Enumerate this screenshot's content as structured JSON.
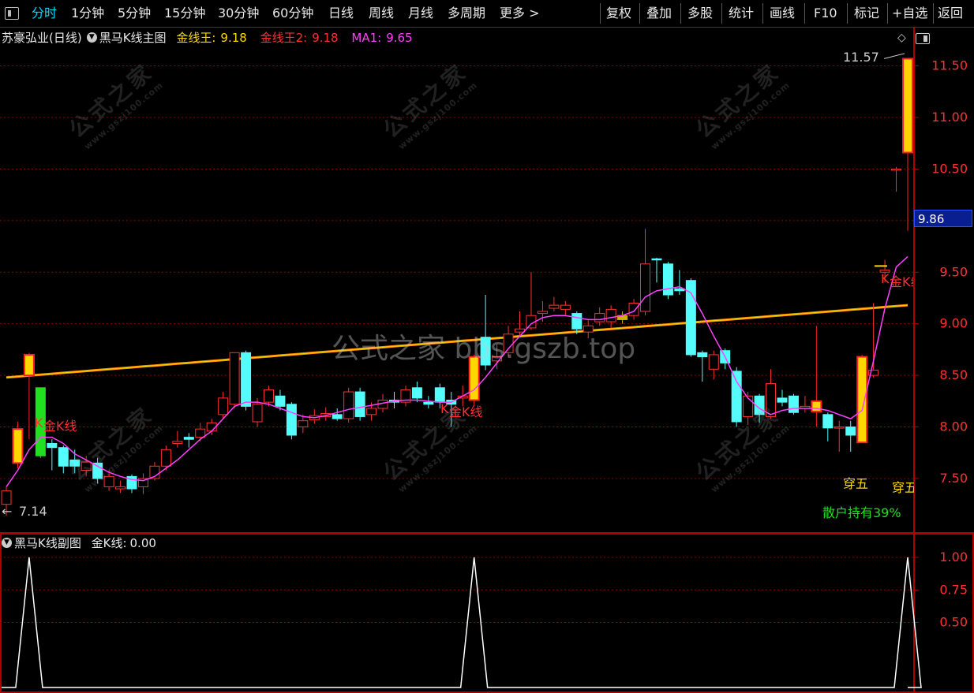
{
  "toolbar": {
    "tabs": [
      "分时",
      "1分钟",
      "5分钟",
      "15分钟",
      "30分钟",
      "60分钟",
      "日线",
      "周线",
      "月线",
      "多周期",
      "更多 >"
    ],
    "right": [
      "复权",
      "叠加",
      "多股",
      "统计",
      "画线",
      "F10",
      "标记",
      "+自选",
      "返回"
    ]
  },
  "main_panel": {
    "stock": "苏豪弘业(日线)",
    "indicator": "黑马K线主图",
    "legend": [
      {
        "name": "金线王:",
        "value": "9.18",
        "color": "#ffd700"
      },
      {
        "name": "金线王2:",
        "value": "9.18",
        "color": "#ff3030"
      },
      {
        "name": "MA1:",
        "value": "9.65",
        "color": "#ff40ff"
      }
    ],
    "current_price": "9.86",
    "high_label": "11.57",
    "low_label": "7.14",
    "signal_label": "金K线",
    "signal_prefix": "K",
    "cross_label": "穿五",
    "retail_hold": "散户持有39%"
  },
  "sub_panel": {
    "indicator": "黑马K线副图",
    "legend_name": "金K线:",
    "legend_value": "0.00"
  },
  "watermark": {
    "center": "公式之家 bbs.gszb.top",
    "diagonal_big": "公式之家",
    "diagonal_small": "www.gszj100.com"
  },
  "colors": {
    "up": "#ff3030",
    "down": "#54fcfc",
    "gold": "#ffd700",
    "ma": "#ff40ff",
    "grid": "#8b0000",
    "axis": "#b00000"
  },
  "chart_data": {
    "type": "candlestick",
    "y_ticks": [
      7.5,
      8.0,
      8.5,
      9.0,
      9.5,
      10.0,
      10.5,
      11.0,
      11.5
    ],
    "ylim": [
      6.98,
      11.68
    ],
    "sub_y_ticks": [
      0.5,
      0.75,
      1.0
    ],
    "candles": [
      {
        "o": 7.25,
        "c": 7.38,
        "h": 7.42,
        "l": 7.14
      },
      {
        "o": 7.65,
        "c": 7.98,
        "h": 8.05,
        "l": 7.6,
        "t": "gold"
      },
      {
        "o": 8.5,
        "c": 8.7,
        "h": 8.72,
        "l": 7.88,
        "t": "gold"
      },
      {
        "o": 8.38,
        "c": 7.72,
        "h": 8.38,
        "l": 7.7,
        "t": "green"
      },
      {
        "o": 7.84,
        "c": 7.8,
        "h": 7.88,
        "l": 7.58
      },
      {
        "o": 7.8,
        "c": 7.62,
        "h": 7.82,
        "l": 7.55
      },
      {
        "o": 7.68,
        "c": 7.62,
        "h": 7.78,
        "l": 7.55
      },
      {
        "o": 7.58,
        "c": 7.66,
        "h": 7.72,
        "l": 7.52
      },
      {
        "o": 7.65,
        "c": 7.5,
        "h": 7.7,
        "l": 7.45
      },
      {
        "o": 7.42,
        "c": 7.52,
        "h": 7.58,
        "l": 7.38
      },
      {
        "o": 7.4,
        "c": 7.42,
        "h": 7.48,
        "l": 7.36
      },
      {
        "o": 7.52,
        "c": 7.4,
        "h": 7.54,
        "l": 7.36
      },
      {
        "o": 7.42,
        "c": 7.5,
        "h": 7.55,
        "l": 7.35
      },
      {
        "o": 7.5,
        "c": 7.62,
        "h": 7.66,
        "l": 7.48
      },
      {
        "o": 7.62,
        "c": 7.78,
        "h": 7.82,
        "l": 7.58
      },
      {
        "o": 7.84,
        "c": 7.86,
        "h": 7.96,
        "l": 7.8
      },
      {
        "o": 7.9,
        "c": 7.88,
        "h": 7.94,
        "l": 7.8
      },
      {
        "o": 7.9,
        "c": 7.98,
        "h": 8.04,
        "l": 7.86
      },
      {
        "o": 7.96,
        "c": 8.04,
        "h": 8.08,
        "l": 7.92
      },
      {
        "o": 8.12,
        "c": 8.28,
        "h": 8.34,
        "l": 8.08
      },
      {
        "o": 8.22,
        "c": 8.72,
        "h": 8.72,
        "l": 8.18
      },
      {
        "o": 8.72,
        "c": 8.2,
        "h": 8.74,
        "l": 8.16
      },
      {
        "o": 8.05,
        "c": 8.22,
        "h": 8.28,
        "l": 8.0
      },
      {
        "o": 8.24,
        "c": 8.36,
        "h": 8.4,
        "l": 8.2
      },
      {
        "o": 8.3,
        "c": 8.2,
        "h": 8.36,
        "l": 8.16
      },
      {
        "o": 8.22,
        "c": 7.92,
        "h": 8.24,
        "l": 7.88
      },
      {
        "o": 8.0,
        "c": 8.06,
        "h": 8.12,
        "l": 7.94
      },
      {
        "o": 8.07,
        "c": 8.11,
        "h": 8.17,
        "l": 8.03
      },
      {
        "o": 8.1,
        "c": 8.13,
        "h": 8.19,
        "l": 8.06
      },
      {
        "o": 8.12,
        "c": 8.08,
        "h": 8.18,
        "l": 8.06
      },
      {
        "o": 8.08,
        "c": 8.34,
        "h": 8.38,
        "l": 8.04
      },
      {
        "o": 8.34,
        "c": 8.1,
        "h": 8.38,
        "l": 8.06
      },
      {
        "o": 8.12,
        "c": 8.18,
        "h": 8.24,
        "l": 8.06
      },
      {
        "o": 8.18,
        "c": 8.26,
        "h": 8.32,
        "l": 8.14
      },
      {
        "o": 8.26,
        "c": 8.24,
        "h": 8.34,
        "l": 8.18
      },
      {
        "o": 8.24,
        "c": 8.36,
        "h": 8.4,
        "l": 8.2
      },
      {
        "o": 8.38,
        "c": 8.28,
        "h": 8.44,
        "l": 8.24
      },
      {
        "o": 8.24,
        "c": 8.22,
        "h": 8.3,
        "l": 8.18
      },
      {
        "o": 8.38,
        "c": 8.24,
        "h": 8.42,
        "l": 8.18
      },
      {
        "o": 8.26,
        "c": 8.22,
        "h": 8.34,
        "l": 8.0
      },
      {
        "o": 8.28,
        "c": 8.3,
        "h": 8.4,
        "l": 8.2
      },
      {
        "o": 8.26,
        "c": 8.68,
        "h": 8.7,
        "l": 8.2,
        "t": "gold"
      },
      {
        "o": 8.87,
        "c": 8.6,
        "h": 9.28,
        "l": 8.55
      },
      {
        "o": 8.64,
        "c": 8.68,
        "h": 8.8,
        "l": 8.56
      },
      {
        "o": 8.72,
        "c": 8.9,
        "h": 8.98,
        "l": 8.68
      },
      {
        "o": 8.92,
        "c": 8.95,
        "h": 9.12,
        "l": 8.88
      },
      {
        "o": 8.96,
        "c": 9.08,
        "h": 9.5,
        "l": 8.94
      },
      {
        "o": 9.1,
        "c": 9.12,
        "h": 9.22,
        "l": 9.02
      },
      {
        "o": 9.15,
        "c": 9.18,
        "h": 9.26,
        "l": 9.12
      },
      {
        "o": 9.14,
        "c": 9.18,
        "h": 9.22,
        "l": 9.08
      },
      {
        "o": 9.1,
        "c": 8.95,
        "h": 9.12,
        "l": 8.9
      },
      {
        "o": 8.92,
        "c": 8.98,
        "h": 9.04,
        "l": 8.86
      },
      {
        "o": 9.02,
        "c": 9.1,
        "h": 9.16,
        "l": 8.98
      },
      {
        "o": 9.02,
        "c": 9.14,
        "h": 9.18,
        "l": 8.96
      },
      {
        "o": 9.08,
        "c": 9.04,
        "h": 9.12,
        "l": 9.0,
        "t": "olive"
      },
      {
        "o": 9.08,
        "c": 9.2,
        "h": 9.24,
        "l": 9.04
      },
      {
        "o": 9.12,
        "c": 9.58,
        "h": 9.92,
        "l": 9.08
      },
      {
        "o": 9.63,
        "c": 9.62,
        "h": 9.64,
        "l": 9.4
      },
      {
        "o": 9.58,
        "c": 9.28,
        "h": 9.6,
        "l": 9.24
      },
      {
        "o": 9.34,
        "c": 9.32,
        "h": 9.52,
        "l": 9.28
      },
      {
        "o": 9.42,
        "c": 8.7,
        "h": 9.44,
        "l": 8.68
      },
      {
        "o": 8.72,
        "c": 8.68,
        "h": 8.74,
        "l": 8.44
      },
      {
        "o": 8.56,
        "c": 8.7,
        "h": 8.74,
        "l": 8.46
      },
      {
        "o": 8.74,
        "c": 8.62,
        "h": 8.76,
        "l": 8.56
      },
      {
        "o": 8.54,
        "c": 8.05,
        "h": 8.58,
        "l": 8.0
      },
      {
        "o": 8.1,
        "c": 8.3,
        "h": 8.34,
        "l": 8.02
      },
      {
        "o": 8.3,
        "c": 8.12,
        "h": 8.32,
        "l": 8.04
      },
      {
        "o": 8.1,
        "c": 8.42,
        "h": 8.56,
        "l": 8.08
      },
      {
        "o": 8.28,
        "c": 8.24,
        "h": 8.36,
        "l": 8.2
      },
      {
        "o": 8.3,
        "c": 8.14,
        "h": 8.32,
        "l": 8.12
      },
      {
        "o": 8.18,
        "c": 8.2,
        "h": 8.3,
        "l": 8.14
      },
      {
        "o": 8.15,
        "c": 8.25,
        "h": 8.98,
        "l": 8.0,
        "t": "gold"
      },
      {
        "o": 8.12,
        "c": 7.99,
        "h": 8.14,
        "l": 7.86
      },
      {
        "o": 7.99,
        "c": 8.0,
        "h": 8.06,
        "l": 7.76
      },
      {
        "o": 8.0,
        "c": 7.92,
        "h": 8.06,
        "l": 7.76
      },
      {
        "o": 7.85,
        "c": 8.68,
        "h": 8.7,
        "l": 7.85,
        "t": "gold"
      },
      {
        "o": 8.5,
        "c": 8.55,
        "h": 9.2,
        "l": 8.48
      },
      {
        "o": 9.5,
        "c": 9.52,
        "h": 9.62,
        "l": 9.4
      },
      {
        "o": 10.5,
        "c": 10.5,
        "h": 10.52,
        "l": 10.28
      },
      {
        "o": 10.66,
        "c": 11.57,
        "h": 11.57,
        "l": 9.9,
        "t": "gold"
      }
    ],
    "ma": [
      7.42,
      7.58,
      7.78,
      7.9,
      7.9,
      7.84,
      7.74,
      7.68,
      7.62,
      7.56,
      7.52,
      7.49,
      7.48,
      7.52,
      7.6,
      7.68,
      7.78,
      7.88,
      7.96,
      8.08,
      8.2,
      8.24,
      8.24,
      8.22,
      8.18,
      8.14,
      8.1,
      8.09,
      8.11,
      8.14,
      8.17,
      8.19,
      8.21,
      8.23,
      8.25,
      8.26,
      8.26,
      8.25,
      8.24,
      8.24,
      8.3,
      8.36,
      8.48,
      8.62,
      8.76,
      8.88,
      9.0,
      9.06,
      9.08,
      9.08,
      9.06,
      9.04,
      9.04,
      9.06,
      9.08,
      9.12,
      9.26,
      9.32,
      9.34,
      9.36,
      9.3,
      9.1,
      8.88,
      8.68,
      8.44,
      8.28,
      8.18,
      8.12,
      8.16,
      8.18,
      8.18,
      8.18,
      8.16,
      8.12,
      8.08,
      8.16,
      8.64,
      9.15,
      9.55,
      9.65
    ],
    "gold_line": {
      "start": 8.48,
      "end": 9.18
    },
    "sub_signal_index": [
      2,
      41,
      79
    ]
  }
}
